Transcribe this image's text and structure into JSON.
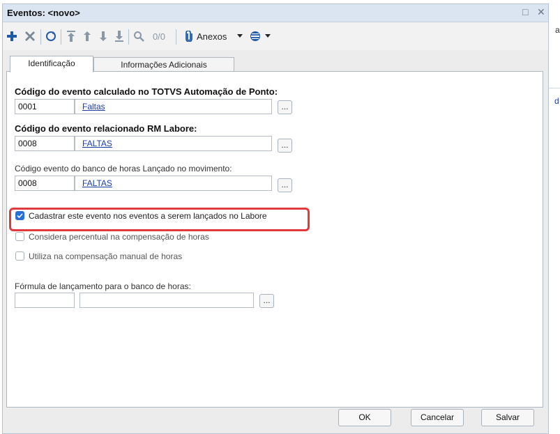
{
  "window": {
    "title": "Eventos: <novo>",
    "controls": {
      "maximize": "□",
      "close": "✕"
    }
  },
  "toolbar": {
    "record_count": "0/0",
    "attachments_label": "Anexos",
    "icons": [
      "add-icon",
      "delete-icon",
      "refresh-icon",
      "first-icon",
      "previous-icon",
      "next-icon",
      "last-icon",
      "search-icon",
      "paperclip-icon",
      "chevron-down-icon",
      "globe-icon",
      "chevron-down-icon"
    ]
  },
  "tabs": [
    {
      "label": "Identificação",
      "active": true
    },
    {
      "label": "Informações Adicionais",
      "active": false
    }
  ],
  "form": {
    "field1": {
      "label": "Código do evento calculado no TOTVS Automação de Ponto:",
      "code": "0001",
      "description": "Faltas",
      "lookup": "..."
    },
    "field2": {
      "label": "Código do evento relacionado RM Labore:",
      "code": "0008",
      "description": "FALTAS",
      "lookup": "..."
    },
    "field3": {
      "label": "Código evento do banco de horas Lançado no movimento:",
      "code": "0008",
      "description": "FALTAS",
      "lookup": "..."
    },
    "checkboxes": [
      {
        "label": "Cadastrar este evento nos eventos a serem lançados no Labore",
        "checked": true
      },
      {
        "label": "Considera percentual na compensação de horas",
        "checked": false
      },
      {
        "label": "Utiliza na compensação manual de horas",
        "checked": false
      }
    ],
    "formula": {
      "label": "Fórmula de lançamento para o banco de horas:",
      "code": "",
      "description": "",
      "lookup": "..."
    }
  },
  "buttons": {
    "ok": "OK",
    "cancel": "Cancelar",
    "save": "Salvar"
  },
  "background": {
    "fragment1": "a",
    "fragment2": "d"
  },
  "colors": {
    "accent": "#2a6fd6",
    "highlight": "#e03a3e",
    "titlebar": "#dbe5f2",
    "link": "#1a3ea8",
    "toolbar_icon": "#1f5aa8"
  }
}
